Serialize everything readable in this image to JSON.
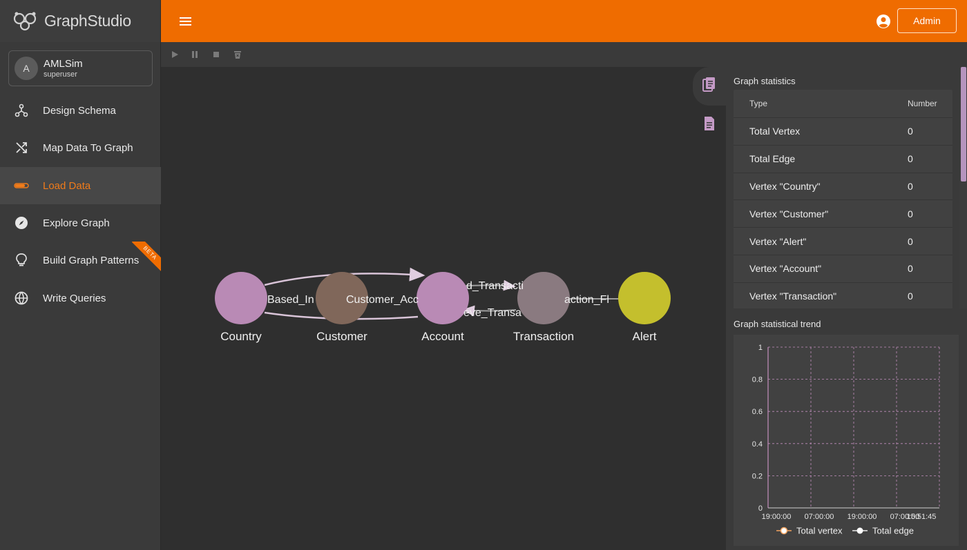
{
  "brand": {
    "name": "GraphStudio",
    "logo_icon": "graphstudio-logo-icon"
  },
  "user": {
    "initial": "A",
    "name": "AMLSim",
    "role": "superuser"
  },
  "nav": {
    "items": [
      {
        "label": "Design Schema",
        "icon": "schema-icon",
        "active": false
      },
      {
        "label": "Map Data To Graph",
        "icon": "shuffle-icon",
        "active": false
      },
      {
        "label": "Load Data",
        "icon": "progress-bar-icon",
        "active": true
      },
      {
        "label": "Explore Graph",
        "icon": "compass-icon",
        "active": false
      },
      {
        "label": "Build Graph Patterns",
        "icon": "lightbulb-icon",
        "active": false,
        "badge": "BETA"
      },
      {
        "label": "Write Queries",
        "icon": "globe-icon",
        "active": false
      }
    ]
  },
  "header": {
    "admin_label": "Admin",
    "accent_color": "#ef6c00"
  },
  "toolbar": {
    "buttons": [
      "play-icon",
      "pause-icon",
      "stop-icon",
      "delete-icon"
    ]
  },
  "graph": {
    "vertices": [
      {
        "label": "Country",
        "color": "#b98ab5"
      },
      {
        "label": "Customer",
        "color": "#80675a"
      },
      {
        "label": "Account",
        "color": "#b98ab5"
      },
      {
        "label": "Transaction",
        "color": "#8a7a80"
      },
      {
        "label": "Alert",
        "color": "#c4bf2d"
      }
    ],
    "edge_labels": [
      "Based_In",
      "Customer_Acc",
      "d_Transacti",
      "eve_Transa",
      "action_Fl"
    ]
  },
  "stats": {
    "title": "Graph statistics",
    "headers": {
      "type": "Type",
      "number": "Number"
    },
    "rows": [
      {
        "type": "Total Vertex",
        "number": "0"
      },
      {
        "type": "Total Edge",
        "number": "0"
      },
      {
        "type": "Vertex \"Country\"",
        "number": "0"
      },
      {
        "type": "Vertex \"Customer\"",
        "number": "0"
      },
      {
        "type": "Vertex \"Alert\"",
        "number": "0"
      },
      {
        "type": "Vertex \"Account\"",
        "number": "0"
      },
      {
        "type": "Vertex \"Transaction\"",
        "number": "0"
      }
    ]
  },
  "trend": {
    "title": "Graph statistical trend",
    "legend": {
      "vertex": "Total vertex",
      "edge": "Total edge"
    }
  },
  "chart_data": {
    "type": "line",
    "yticks": [
      "0",
      "0.2",
      "0.4",
      "0.6",
      "0.8",
      "1"
    ],
    "xticks": [
      "19:00:00",
      "07:00:00",
      "19:00:00",
      "07:00:00",
      "15:51:45"
    ],
    "ylim": [
      0,
      1
    ],
    "grid": true,
    "legend_placement": "bottom",
    "series": [
      {
        "name": "Total vertex",
        "values": []
      },
      {
        "name": "Total edge",
        "values": []
      }
    ]
  }
}
